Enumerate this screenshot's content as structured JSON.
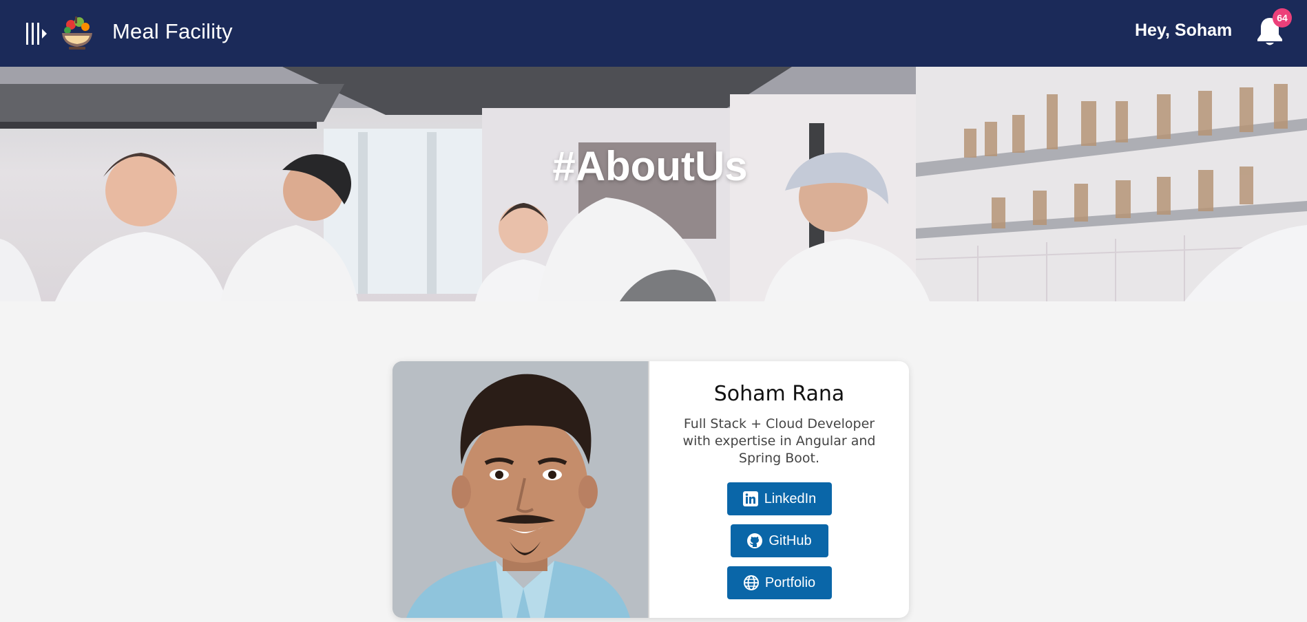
{
  "header": {
    "app_title": "Meal Facility",
    "greeting": "Hey, Soham",
    "notification_count": "64",
    "background_color": "#1b2a59",
    "badge_color": "#ec407a"
  },
  "banner": {
    "title": "#AboutUs"
  },
  "profile": {
    "name": "Soham Rana",
    "bio": "Full Stack + Cloud Developer with expertise in Angular and Spring Boot.",
    "buttons": {
      "linkedin": "LinkedIn",
      "github": "GitHub",
      "portfolio": "Portfolio"
    },
    "button_color": "#0a66a8"
  },
  "icons": {
    "menu": "menu-toggle-icon",
    "logo": "salad-bowl-icon",
    "notifications": "bell-icon",
    "linkedin": "linkedin-icon",
    "github": "github-icon",
    "portfolio": "globe-icon"
  }
}
